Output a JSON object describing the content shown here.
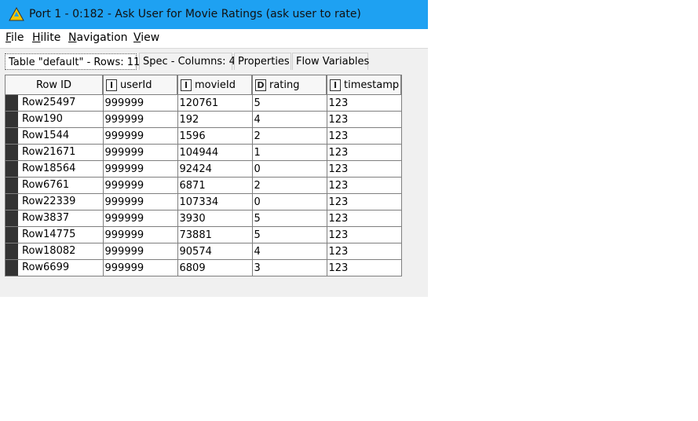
{
  "window": {
    "title": "Port 1 - 0:182 - Ask User for Movie Ratings (ask user to rate)"
  },
  "menu": {
    "items": [
      "File",
      "Hilite",
      "Navigation",
      "View"
    ]
  },
  "tabs": {
    "items": [
      "Table \"default\" - Rows: 11",
      "Spec - Columns: 4",
      "Properties",
      "Flow Variables"
    ],
    "active": "Table \"default\" - Rows: 11"
  },
  "table": {
    "headers": {
      "row_id": "Row ID",
      "columns": [
        {
          "type": "I",
          "name": "userId"
        },
        {
          "type": "I",
          "name": "movieId"
        },
        {
          "type": "D",
          "name": "rating"
        },
        {
          "type": "I",
          "name": "timestamp"
        }
      ]
    },
    "rows": [
      [
        "Row25497",
        "999999",
        "120761",
        "5",
        "123"
      ],
      [
        "Row190",
        "999999",
        "192",
        "4",
        "123"
      ],
      [
        "Row1544",
        "999999",
        "1596",
        "2",
        "123"
      ],
      [
        "Row21671",
        "999999",
        "104944",
        "1",
        "123"
      ],
      [
        "Row18564",
        "999999",
        "92424",
        "0",
        "123"
      ],
      [
        "Row6761",
        "999999",
        "6871",
        "2",
        "123"
      ],
      [
        "Row22339",
        "999999",
        "107334",
        "0",
        "123"
      ],
      [
        "Row3837",
        "999999",
        "3930",
        "5",
        "123"
      ],
      [
        "Row14775",
        "999999",
        "73881",
        "5",
        "123"
      ],
      [
        "Row18082",
        "999999",
        "90574",
        "4",
        "123"
      ],
      [
        "Row6699",
        "999999",
        "6809",
        "3",
        "123"
      ]
    ]
  },
  "colors": {
    "title_bar": "#1ea1f2",
    "background": "#f0f0f0"
  }
}
